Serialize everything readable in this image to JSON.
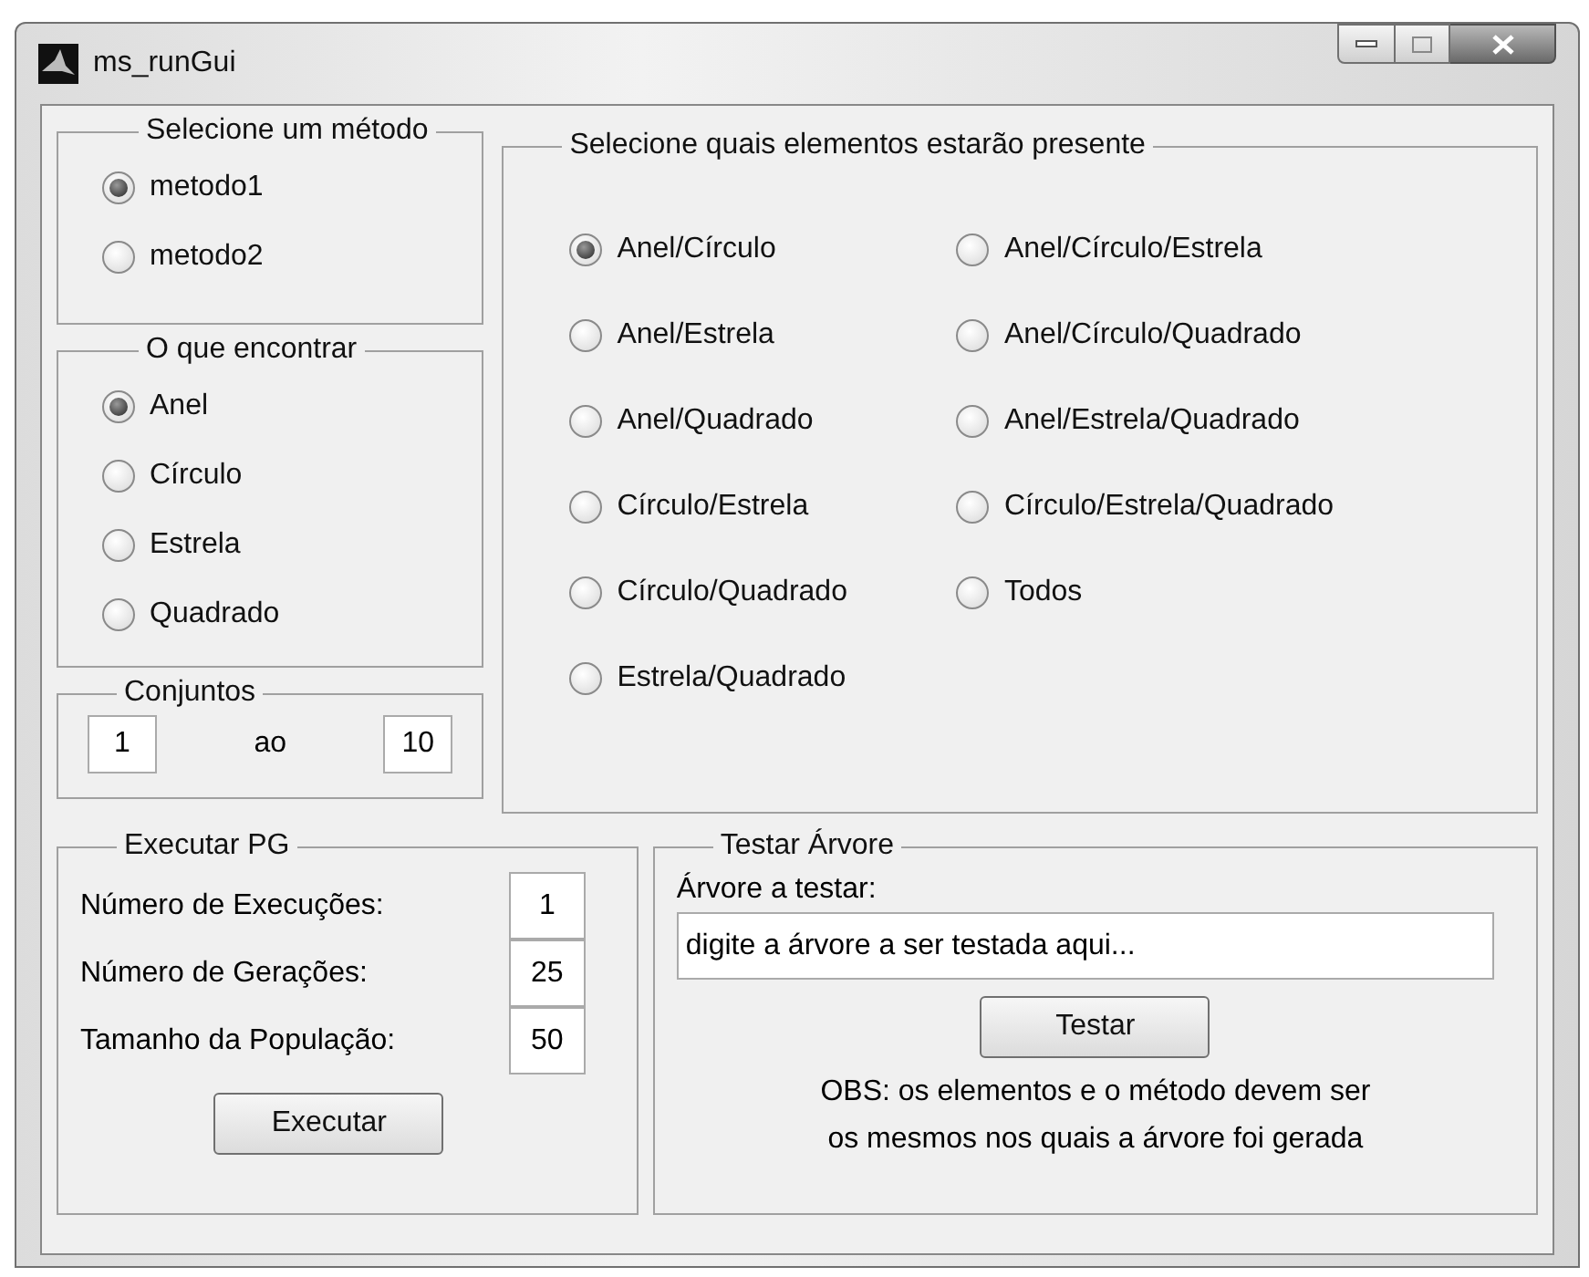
{
  "window": {
    "title": "ms_runGui"
  },
  "method_group": {
    "title": "Selecione um método",
    "options": [
      {
        "label": "metodo1",
        "selected": true
      },
      {
        "label": "metodo2",
        "selected": false
      }
    ]
  },
  "find_group": {
    "title": "O que encontrar",
    "options": [
      {
        "label": "Anel",
        "selected": true
      },
      {
        "label": "Círculo",
        "selected": false
      },
      {
        "label": "Estrela",
        "selected": false
      },
      {
        "label": "Quadrado",
        "selected": false
      }
    ]
  },
  "sets_group": {
    "title": "Conjuntos",
    "from": "1",
    "separator": "ao",
    "to": "10"
  },
  "elements_group": {
    "title": "Selecione quais elementos estarão presente",
    "columns": [
      [
        {
          "label": "Anel/Círculo",
          "selected": true
        },
        {
          "label": "Anel/Estrela",
          "selected": false
        },
        {
          "label": "Anel/Quadrado",
          "selected": false
        },
        {
          "label": "Círculo/Estrela",
          "selected": false
        },
        {
          "label": "Círculo/Quadrado",
          "selected": false
        },
        {
          "label": "Estrela/Quadrado",
          "selected": false
        }
      ],
      [
        {
          "label": "Anel/Círculo/Estrela",
          "selected": false
        },
        {
          "label": "Anel/Círculo/Quadrado",
          "selected": false
        },
        {
          "label": "Anel/Estrela/Quadrado",
          "selected": false
        },
        {
          "label": "Círculo/Estrela/Quadrado",
          "selected": false
        },
        {
          "label": "Todos",
          "selected": false
        }
      ]
    ]
  },
  "run_group": {
    "title": "Executar PG",
    "fields": [
      {
        "label": "Número de Execuções:",
        "value": "1"
      },
      {
        "label": "Número de Gerações:",
        "value": "25"
      },
      {
        "label": "Tamanho da População:",
        "value": "50"
      }
    ],
    "button": "Executar"
  },
  "test_group": {
    "title": "Testar Árvore",
    "field_label": "Árvore a testar:",
    "field_value": "digite a árvore a ser testada aqui...",
    "button": "Testar",
    "note_lines": [
      "OBS: os elementos e o método devem ser",
      "os mesmos nos quais a árvore foi gerada"
    ]
  }
}
